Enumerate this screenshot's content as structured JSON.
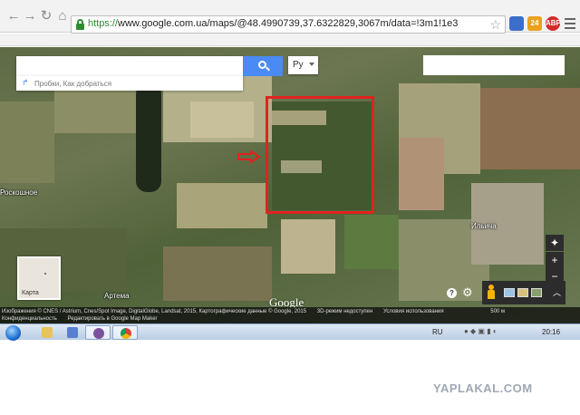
{
  "browser": {
    "url_scheme": "https://",
    "url_rest": "www.google.com.ua/maps/@48.4990739,37.6322829,3067m/data=!3m1!1e3",
    "back_icon": "back-arrow-icon",
    "forward_icon": "forward-arrow-icon",
    "reload_icon": "reload-icon",
    "home_icon": "home-icon",
    "ext_badge_1": "24",
    "ext_badge_2": "ABP"
  },
  "maps": {
    "search_placeholder": "",
    "directions_hint": "Пробки, Как добраться",
    "language": "Ру",
    "minimap_label": "Карта",
    "logo": "Google",
    "places": {
      "roskoshnoe": "Роскошное",
      "artema": "Артема",
      "ilicha": "Ильича"
    },
    "attribution": "Изображения © CNES / Astrium, Cnes/Spot Image, DigitalGlobe, Landsat, 2015, Картографические данные © Google, 2015",
    "footer_links": [
      "3D-режим недоступен",
      "Условия использования",
      "500 м"
    ],
    "footer_row2": [
      "Конфиденциальность",
      "Редактировать в Google Map Maker"
    ],
    "zoom_in": "+",
    "zoom_out": "−",
    "help": "?"
  },
  "taskbar": {
    "lang": "RU",
    "clock": "20:16"
  },
  "watermark": "YAPLAKAL.COM",
  "colors": {
    "accent": "#4a8af4",
    "highlight": "#e0231f"
  }
}
